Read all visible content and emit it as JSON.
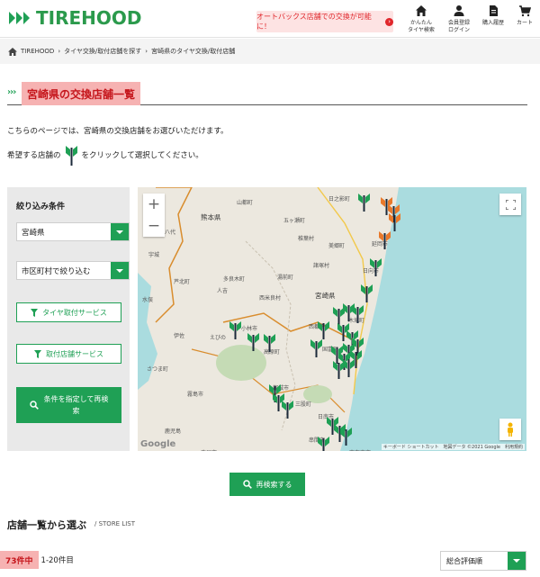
{
  "header": {
    "logo_text": "TIREHOOD",
    "promo_text": "オートバックス店舗での交換が可能に！",
    "nav": [
      {
        "label": "かんたん\nタイヤ検索",
        "icon": "home-icon"
      },
      {
        "label": "会員登録\nログイン",
        "icon": "user-icon"
      },
      {
        "label": "購入履歴",
        "icon": "document-icon"
      },
      {
        "label": "カート",
        "icon": "cart-icon"
      }
    ]
  },
  "breadcrumb": [
    "TIREHOOD",
    "タイヤ交換/取付店舗を探す",
    "宮崎県のタイヤ交換/取付店舗"
  ],
  "section_title": "宮崎県の交換店舗一覧",
  "intro": {
    "line1": "こちらのページでは、宮崎県の交換店舗をお選びいただけます。",
    "line2_before": "希望する店舗の",
    "line2_after": "をクリックして選択してください。"
  },
  "filter": {
    "title": "絞り込み条件",
    "prefecture": "宮崎県",
    "city_placeholder": "市区町村で絞り込む",
    "tire_service_button": "タイヤ取付サービス",
    "store_service_button": "取付店舗サービス",
    "search_button": "条件を指定して再検索"
  },
  "map": {
    "labels": [
      {
        "text": "熊本県",
        "cls": "pref"
      },
      {
        "text": "宮崎県",
        "cls": "pref"
      },
      {
        "text": "日之影町",
        "cls": ""
      },
      {
        "text": "延岡市",
        "cls": ""
      },
      {
        "text": "五ヶ瀬町",
        "cls": ""
      },
      {
        "text": "椎葉村",
        "cls": ""
      },
      {
        "text": "美郷町",
        "cls": ""
      },
      {
        "text": "日向市",
        "cls": ""
      },
      {
        "text": "諸塚村",
        "cls": ""
      },
      {
        "text": "多良木町",
        "cls": ""
      },
      {
        "text": "湯前町",
        "cls": ""
      },
      {
        "text": "西米良村",
        "cls": ""
      },
      {
        "text": "人吉",
        "cls": ""
      },
      {
        "text": "木城町",
        "cls": ""
      },
      {
        "text": "西都市",
        "cls": ""
      },
      {
        "text": "小林市",
        "cls": ""
      },
      {
        "text": "えびの",
        "cls": ""
      },
      {
        "text": "高原町",
        "cls": ""
      },
      {
        "text": "都城市",
        "cls": ""
      },
      {
        "text": "日南市",
        "cls": ""
      },
      {
        "text": "串間市",
        "cls": ""
      },
      {
        "text": "鹿児島",
        "cls": ""
      },
      {
        "text": "霧島市",
        "cls": ""
      },
      {
        "text": "伊佐",
        "cls": ""
      },
      {
        "text": "水俣",
        "cls": ""
      },
      {
        "text": "さつま町",
        "cls": ""
      },
      {
        "text": "宇城",
        "cls": ""
      },
      {
        "text": "八代",
        "cls": ""
      },
      {
        "text": "山都町",
        "cls": ""
      },
      {
        "text": "芦北町",
        "cls": ""
      },
      {
        "text": "三股町",
        "cls": ""
      },
      {
        "text": "国富町",
        "cls": ""
      },
      {
        "text": "志布志市",
        "cls": ""
      },
      {
        "text": "鹿屋市",
        "cls": ""
      }
    ],
    "attribution": "キーボード ショートカット　地図データ ©2021 Google　利用規約",
    "google_logo": "Google"
  },
  "research_button": "再検索する",
  "store_list": {
    "title": "店舗一覧から選ぶ",
    "subtitle": "/ STORE LIST",
    "count": "73件中",
    "range": "1-20件目",
    "sort": "総合評価順"
  },
  "colors": {
    "brand_green": "#1fa055",
    "highlight_red": "#c5161c",
    "highlight_pink": "#f6b2b2"
  }
}
